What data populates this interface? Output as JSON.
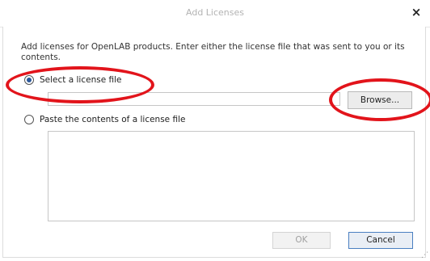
{
  "dialog": {
    "title": "Add Licenses",
    "close_glyph": "×",
    "instructions": "Add licenses for OpenLAB products. Enter either the license file that was sent to you or its contents.",
    "options": {
      "select_file_label": "Select a license file",
      "select_file_checked": true,
      "paste_contents_label": "Paste the contents of a license file",
      "paste_contents_checked": false
    },
    "file_path_value": "",
    "contents_value": "",
    "browse_label": "Browse...",
    "ok_label": "OK",
    "cancel_label": "Cancel",
    "ok_enabled": false
  },
  "annotations": {
    "color": "#e2141b",
    "shape": "ellipse"
  }
}
